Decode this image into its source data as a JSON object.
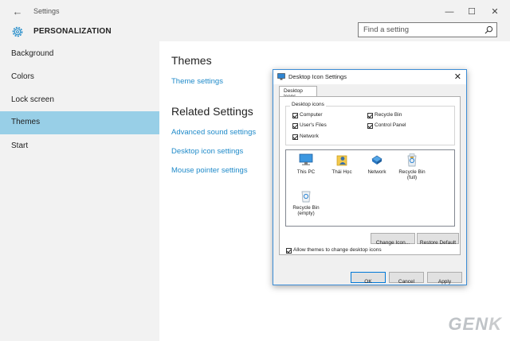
{
  "window": {
    "title": "Settings",
    "back_icon": "back-arrow-icon",
    "controls": {
      "minimize": "—",
      "maximize": "☐",
      "close": "✕"
    }
  },
  "header": {
    "title": "PERSONALIZATION",
    "icon": "gear-icon",
    "search_placeholder": "Find a setting"
  },
  "sidebar": {
    "items": [
      {
        "label": "Background",
        "active": false
      },
      {
        "label": "Colors",
        "active": false
      },
      {
        "label": "Lock screen",
        "active": false
      },
      {
        "label": "Themes",
        "active": true
      },
      {
        "label": "Start",
        "active": false
      }
    ],
    "active_color": "#98cfe7"
  },
  "main": {
    "themes_heading": "Themes",
    "theme_settings_link": "Theme settings",
    "related_heading": "Related Settings",
    "related_links": [
      "Advanced sound settings",
      "Desktop icon settings",
      "Mouse pointer settings"
    ],
    "link_color": "#1f8ac9"
  },
  "dialog": {
    "title": "Desktop Icon Settings",
    "close": "✕",
    "tab": "Desktop Icons",
    "group_label": "Desktop icons",
    "checkboxes": [
      {
        "label": "Computer",
        "checked": true
      },
      {
        "label": "Recycle Bin",
        "checked": true
      },
      {
        "label": "User's Files",
        "checked": true
      },
      {
        "label": "Control Panel",
        "checked": true
      },
      {
        "label": "Network",
        "checked": true
      }
    ],
    "icons": [
      {
        "label": "This PC",
        "icon": "computer-icon"
      },
      {
        "label": "Thái Học",
        "icon": "user-folder-icon"
      },
      {
        "label": "Network",
        "icon": "network-icon"
      },
      {
        "label": "Recycle Bin\n(full)",
        "icon": "recycle-bin-full-icon"
      },
      {
        "label": "Recycle Bin\n(empty)",
        "icon": "recycle-bin-empty-icon"
      }
    ],
    "change_icon_button": "Change Icon...",
    "restore_default_button": "Restore Default",
    "allow_themes_label": "Allow themes to change desktop icons",
    "allow_themes_checked": true,
    "ok_button": "OK",
    "cancel_button": "Cancel",
    "apply_button": "Apply"
  },
  "watermark": {
    "text": "GEN",
    "text_k": "K"
  }
}
